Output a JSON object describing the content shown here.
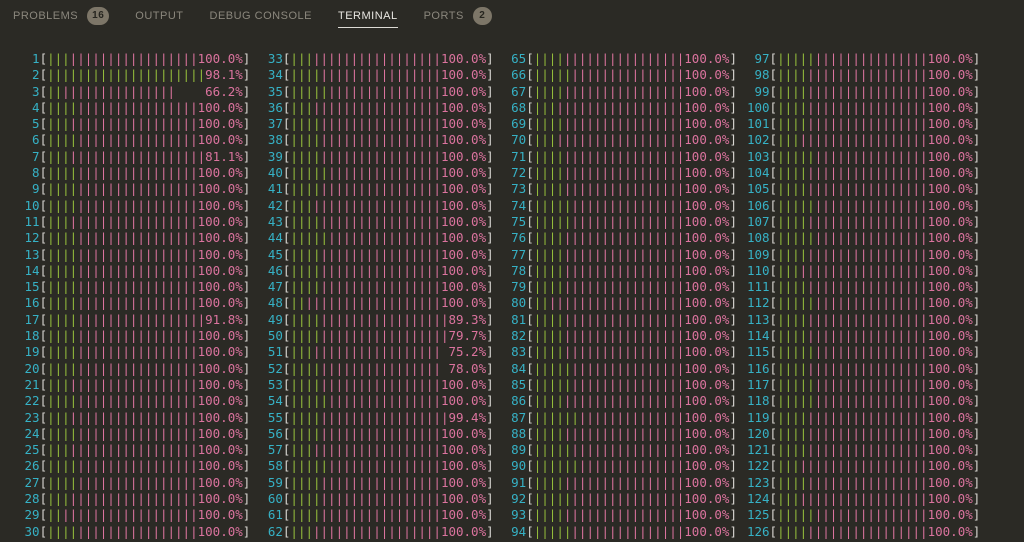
{
  "panel_tabs": {
    "items": [
      {
        "label": "PROBLEMS",
        "badge": "16",
        "active": false
      },
      {
        "label": "OUTPUT",
        "badge": null,
        "active": false
      },
      {
        "label": "DEBUG CONSOLE",
        "badge": null,
        "active": false
      },
      {
        "label": "TERMINAL",
        "badge": null,
        "active": true
      },
      {
        "label": "PORTS",
        "badge": "2",
        "active": false
      }
    ]
  },
  "terminal": {
    "description": "htop-style per-CPU usage meters",
    "meter_width_chars": 26,
    "bar_glyph": "|",
    "colors": {
      "background": "#2b2a25",
      "cpu_id": "#36b1c5",
      "bracket": "#d9d7d2",
      "bar_nice_green": "#93bb3b",
      "bar_busy_pink": "#db739e",
      "percent_text": "#db739e"
    },
    "columns": [
      {
        "cpus": [
          {
            "id": 1,
            "pct": 100.0,
            "green": 3
          },
          {
            "id": 2,
            "pct": 98.1,
            "green": 21
          },
          {
            "id": 3,
            "pct": 66.2,
            "green": 2
          },
          {
            "id": 4,
            "pct": 100.0,
            "green": 4
          },
          {
            "id": 5,
            "pct": 100.0,
            "green": 3
          },
          {
            "id": 6,
            "pct": 100.0,
            "green": 4
          },
          {
            "id": 7,
            "pct": 81.1,
            "green": 3
          },
          {
            "id": 8,
            "pct": 100.0,
            "green": 4
          },
          {
            "id": 9,
            "pct": 100.0,
            "green": 4
          },
          {
            "id": 10,
            "pct": 100.0,
            "green": 4
          },
          {
            "id": 11,
            "pct": 100.0,
            "green": 3
          },
          {
            "id": 12,
            "pct": 100.0,
            "green": 4
          },
          {
            "id": 13,
            "pct": 100.0,
            "green": 4
          },
          {
            "id": 14,
            "pct": 100.0,
            "green": 4
          },
          {
            "id": 15,
            "pct": 100.0,
            "green": 4
          },
          {
            "id": 16,
            "pct": 100.0,
            "green": 4
          },
          {
            "id": 17,
            "pct": 91.8,
            "green": 4
          },
          {
            "id": 18,
            "pct": 100.0,
            "green": 4
          },
          {
            "id": 19,
            "pct": 100.0,
            "green": 4
          },
          {
            "id": 20,
            "pct": 100.0,
            "green": 4
          },
          {
            "id": 21,
            "pct": 100.0,
            "green": 3
          },
          {
            "id": 22,
            "pct": 100.0,
            "green": 4
          },
          {
            "id": 23,
            "pct": 100.0,
            "green": 3
          },
          {
            "id": 24,
            "pct": 100.0,
            "green": 4
          },
          {
            "id": 25,
            "pct": 100.0,
            "green": 3
          },
          {
            "id": 26,
            "pct": 100.0,
            "green": 4
          },
          {
            "id": 27,
            "pct": 100.0,
            "green": 4
          },
          {
            "id": 28,
            "pct": 100.0,
            "green": 3
          },
          {
            "id": 29,
            "pct": 100.0,
            "green": 2
          },
          {
            "id": 30,
            "pct": 100.0,
            "green": 4
          }
        ]
      },
      {
        "cpus": [
          {
            "id": 33,
            "pct": 100.0,
            "green": 3
          },
          {
            "id": 34,
            "pct": 100.0,
            "green": 4
          },
          {
            "id": 35,
            "pct": 100.0,
            "green": 5
          },
          {
            "id": 36,
            "pct": 100.0,
            "green": 3
          },
          {
            "id": 37,
            "pct": 100.0,
            "green": 4
          },
          {
            "id": 38,
            "pct": 100.0,
            "green": 4
          },
          {
            "id": 39,
            "pct": 100.0,
            "green": 4
          },
          {
            "id": 40,
            "pct": 100.0,
            "green": 5
          },
          {
            "id": 41,
            "pct": 100.0,
            "green": 4
          },
          {
            "id": 42,
            "pct": 100.0,
            "green": 3
          },
          {
            "id": 43,
            "pct": 100.0,
            "green": 4
          },
          {
            "id": 44,
            "pct": 100.0,
            "green": 5
          },
          {
            "id": 45,
            "pct": 100.0,
            "green": 4
          },
          {
            "id": 46,
            "pct": 100.0,
            "green": 4
          },
          {
            "id": 47,
            "pct": 100.0,
            "green": 4
          },
          {
            "id": 48,
            "pct": 100.0,
            "green": 2
          },
          {
            "id": 49,
            "pct": 89.3,
            "green": 4
          },
          {
            "id": 50,
            "pct": 79.7,
            "green": 4
          },
          {
            "id": 51,
            "pct": 75.2,
            "green": 3
          },
          {
            "id": 52,
            "pct": 78.0,
            "green": 4
          },
          {
            "id": 53,
            "pct": 100.0,
            "green": 4
          },
          {
            "id": 54,
            "pct": 100.0,
            "green": 5
          },
          {
            "id": 55,
            "pct": 99.4,
            "green": 4
          },
          {
            "id": 56,
            "pct": 100.0,
            "green": 4
          },
          {
            "id": 57,
            "pct": 100.0,
            "green": 3
          },
          {
            "id": 58,
            "pct": 100.0,
            "green": 5
          },
          {
            "id": 59,
            "pct": 100.0,
            "green": 4
          },
          {
            "id": 60,
            "pct": 100.0,
            "green": 4
          },
          {
            "id": 61,
            "pct": 100.0,
            "green": 4
          },
          {
            "id": 62,
            "pct": 100.0,
            "green": 3
          }
        ]
      },
      {
        "cpus": [
          {
            "id": 65,
            "pct": 100.0,
            "green": 4
          },
          {
            "id": 66,
            "pct": 100.0,
            "green": 5
          },
          {
            "id": 67,
            "pct": 100.0,
            "green": 4
          },
          {
            "id": 68,
            "pct": 100.0,
            "green": 3
          },
          {
            "id": 69,
            "pct": 100.0,
            "green": 4
          },
          {
            "id": 70,
            "pct": 100.0,
            "green": 3
          },
          {
            "id": 71,
            "pct": 100.0,
            "green": 4
          },
          {
            "id": 72,
            "pct": 100.0,
            "green": 4
          },
          {
            "id": 73,
            "pct": 100.0,
            "green": 4
          },
          {
            "id": 74,
            "pct": 100.0,
            "green": 5
          },
          {
            "id": 75,
            "pct": 100.0,
            "green": 5
          },
          {
            "id": 76,
            "pct": 100.0,
            "green": 4
          },
          {
            "id": 77,
            "pct": 100.0,
            "green": 4
          },
          {
            "id": 78,
            "pct": 100.0,
            "green": 4
          },
          {
            "id": 79,
            "pct": 100.0,
            "green": 4
          },
          {
            "id": 80,
            "pct": 100.0,
            "green": 2
          },
          {
            "id": 81,
            "pct": 100.0,
            "green": 4
          },
          {
            "id": 82,
            "pct": 100.0,
            "green": 4
          },
          {
            "id": 83,
            "pct": 100.0,
            "green": 4
          },
          {
            "id": 84,
            "pct": 100.0,
            "green": 5
          },
          {
            "id": 85,
            "pct": 100.0,
            "green": 5
          },
          {
            "id": 86,
            "pct": 100.0,
            "green": 4
          },
          {
            "id": 87,
            "pct": 100.0,
            "green": 6
          },
          {
            "id": 88,
            "pct": 100.0,
            "green": 4
          },
          {
            "id": 89,
            "pct": 100.0,
            "green": 5
          },
          {
            "id": 90,
            "pct": 100.0,
            "green": 6
          },
          {
            "id": 91,
            "pct": 100.0,
            "green": 4
          },
          {
            "id": 92,
            "pct": 100.0,
            "green": 5
          },
          {
            "id": 93,
            "pct": 100.0,
            "green": 4
          },
          {
            "id": 94,
            "pct": 100.0,
            "green": 5
          }
        ]
      },
      {
        "cpus": [
          {
            "id": 97,
            "pct": 100.0,
            "green": 5
          },
          {
            "id": 98,
            "pct": 100.0,
            "green": 4
          },
          {
            "id": 99,
            "pct": 100.0,
            "green": 4
          },
          {
            "id": 100,
            "pct": 100.0,
            "green": 4
          },
          {
            "id": 101,
            "pct": 100.0,
            "green": 4
          },
          {
            "id": 102,
            "pct": 100.0,
            "green": 3
          },
          {
            "id": 103,
            "pct": 100.0,
            "green": 5
          },
          {
            "id": 104,
            "pct": 100.0,
            "green": 4
          },
          {
            "id": 105,
            "pct": 100.0,
            "green": 4
          },
          {
            "id": 106,
            "pct": 100.0,
            "green": 5
          },
          {
            "id": 107,
            "pct": 100.0,
            "green": 4
          },
          {
            "id": 108,
            "pct": 100.0,
            "green": 5
          },
          {
            "id": 109,
            "pct": 100.0,
            "green": 4
          },
          {
            "id": 110,
            "pct": 100.0,
            "green": 3
          },
          {
            "id": 111,
            "pct": 100.0,
            "green": 4
          },
          {
            "id": 112,
            "pct": 100.0,
            "green": 5
          },
          {
            "id": 113,
            "pct": 100.0,
            "green": 4
          },
          {
            "id": 114,
            "pct": 100.0,
            "green": 4
          },
          {
            "id": 115,
            "pct": 100.0,
            "green": 5
          },
          {
            "id": 116,
            "pct": 100.0,
            "green": 4
          },
          {
            "id": 117,
            "pct": 100.0,
            "green": 5
          },
          {
            "id": 118,
            "pct": 100.0,
            "green": 5
          },
          {
            "id": 119,
            "pct": 100.0,
            "green": 4
          },
          {
            "id": 120,
            "pct": 100.0,
            "green": 4
          },
          {
            "id": 121,
            "pct": 100.0,
            "green": 4
          },
          {
            "id": 122,
            "pct": 100.0,
            "green": 3
          },
          {
            "id": 123,
            "pct": 100.0,
            "green": 4
          },
          {
            "id": 124,
            "pct": 100.0,
            "green": 3
          },
          {
            "id": 125,
            "pct": 100.0,
            "green": 5
          },
          {
            "id": 126,
            "pct": 100.0,
            "green": 4
          }
        ]
      }
    ]
  }
}
